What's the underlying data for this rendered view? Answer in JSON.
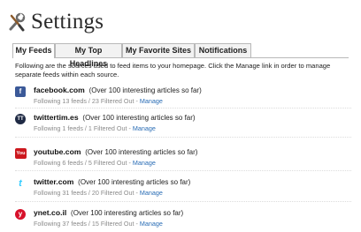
{
  "header": {
    "title": "Settings",
    "icon": "tools-icon"
  },
  "tabs": [
    {
      "label": "My Feeds",
      "active": true
    },
    {
      "label": "My Top Headlines",
      "active": false
    },
    {
      "label": "My Favorite Sites",
      "active": false
    },
    {
      "label": "Notifications",
      "active": false
    }
  ],
  "intro": "Following are the sources used to feed items to your homepage. Click the Manage link in order to manage separate feeds within each source.",
  "feeds": [
    {
      "site": "facebook.com",
      "desc": "(Over 100 interesting articles so far)",
      "stats": "Following 13 feeds / 23 Filtered Out",
      "manage": "Manage",
      "icon": "facebook-icon",
      "color": "#3b5998",
      "glyph": "f"
    },
    {
      "site": "twittertim.es",
      "desc": "(Over 100 interesting articles so far)",
      "stats": "Following 1 feeds / 1 Filtered Out",
      "manage": "Manage",
      "icon": "twittertimes-icon",
      "color": "#1f2a44",
      "glyph": "TT"
    },
    {
      "site": "youtube.com",
      "desc": "(Over 100 interesting articles so far)",
      "stats": "Following 6 feeds / 5 Filtered Out",
      "manage": "Manage",
      "icon": "youtube-icon",
      "color": "#cc181e",
      "glyph": "You"
    },
    {
      "site": "twitter.com",
      "desc": "(Over 100 interesting articles so far)",
      "stats": "Following 31 feeds / 20 Filtered Out",
      "manage": "Manage",
      "icon": "twitter-bird-icon",
      "color": "#33ccff",
      "glyph": "t"
    },
    {
      "site": "ynet.co.il",
      "desc": "(Over 100 interesting articles so far)",
      "stats": "Following 37 feeds / 15 Filtered Out",
      "manage": "Manage",
      "icon": "ynet-icon",
      "color": "#d7112b",
      "glyph": "y"
    }
  ]
}
